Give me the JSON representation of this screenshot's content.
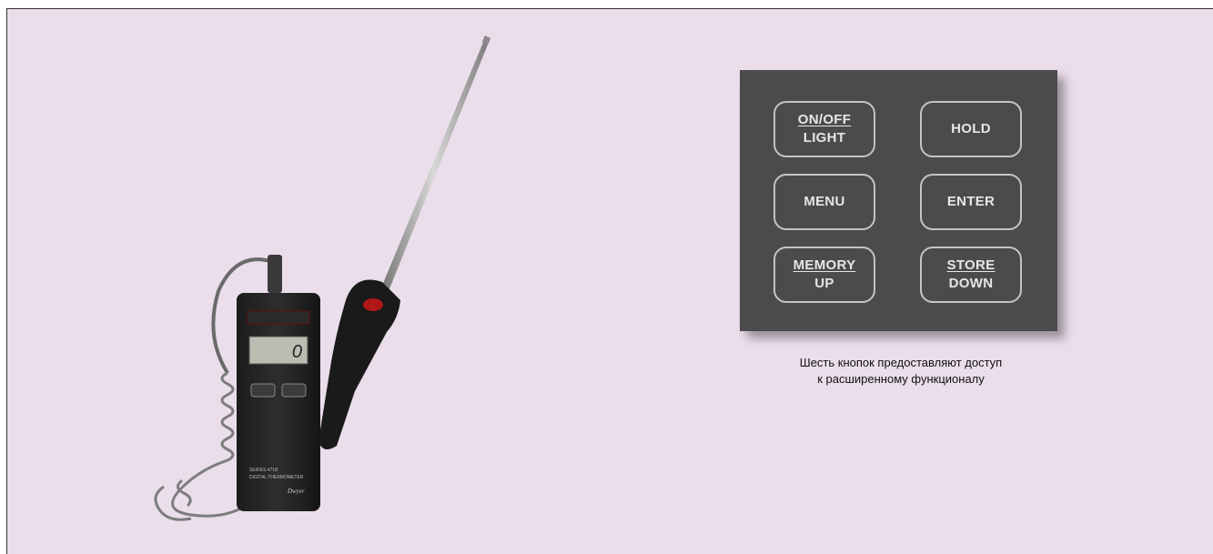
{
  "keypad": {
    "buttons": [
      {
        "top": "ON/OFF",
        "bottom": "LIGHT"
      },
      {
        "label": "HOLD"
      },
      {
        "label": "MENU"
      },
      {
        "label": "ENTER"
      },
      {
        "top": "MEMORY",
        "bottom": "UP"
      },
      {
        "top": "STORE",
        "bottom": "DOWN"
      }
    ]
  },
  "caption": {
    "line1": "Шесть кнопок предоставляют доступ",
    "line2": "к расширенному функционалу"
  },
  "device": {
    "display_value": "0",
    "brand": "Dwyer",
    "model_text": "SERIES 471B DIGITAL THERMOMETER"
  },
  "colors": {
    "background": "#ebdeeb",
    "panel": "#4b4b4d",
    "button_border": "#c4c4c4",
    "button_text": "#e6e6e6"
  }
}
